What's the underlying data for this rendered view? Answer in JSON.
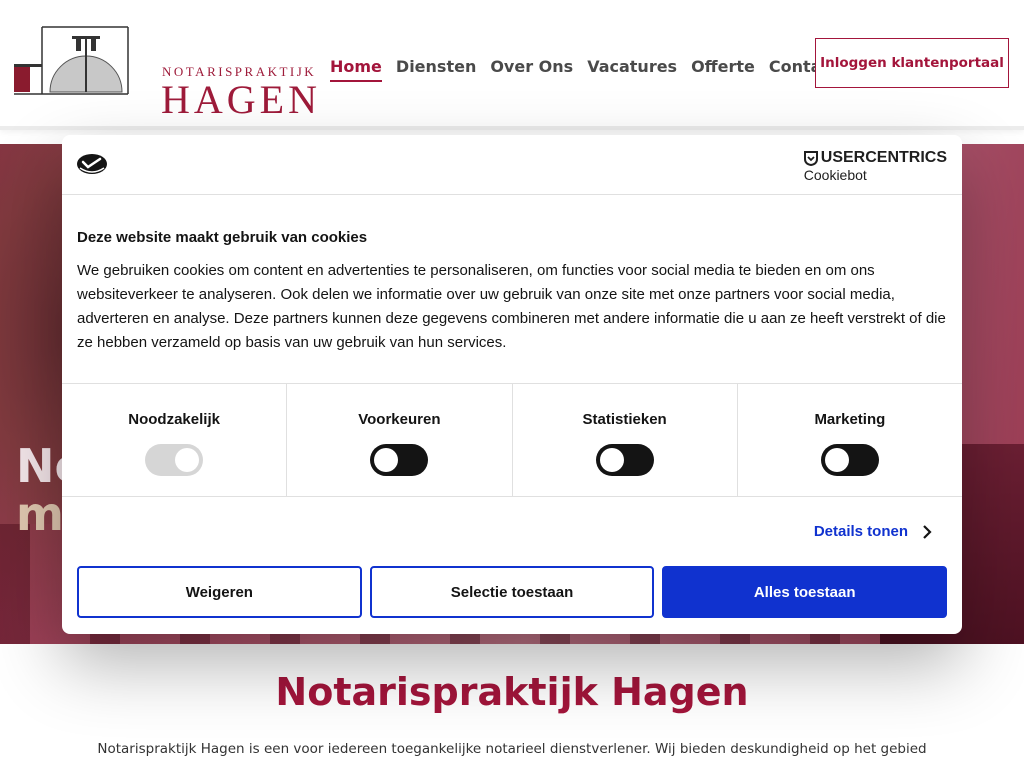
{
  "header": {
    "logo_small": "NOTARISPRAKTIJK",
    "logo_big": "HAGEN",
    "nav": [
      "Home",
      "Diensten",
      "Over Ons",
      "Vacatures",
      "Offerte",
      "Contact"
    ],
    "portal_button": "Inloggen klantenportaal",
    "brand_color": "#a3153b"
  },
  "hero": {
    "text_line1": "Ne",
    "text_line2": "m"
  },
  "intro": {
    "title": "Notarispraktijk Hagen",
    "text": "Notarispraktijk Hagen is een voor iedereen toegankelijke notarieel dienstverlener. Wij bieden deskundigheid op het gebied"
  },
  "cookie": {
    "provider": "USERCENTRICS",
    "provider_sub": "Cookiebot",
    "title": "Deze website maakt gebruik van cookies",
    "text": "We gebruiken cookies om content en advertenties te personaliseren, om functies voor social media te bieden en om ons websiteverkeer te analyseren. Ook delen we informatie over uw gebruik van onze site met onze partners voor social media, adverteren en analyse. Deze partners kunnen deze gegevens combineren met andere informatie die u aan ze heeft verstrekt of die ze hebben verzameld op basis van uw gebruik van hun services.",
    "categories": [
      {
        "label": "Noodzakelijk",
        "state": "on-disabled"
      },
      {
        "label": "Voorkeuren",
        "state": "off"
      },
      {
        "label": "Statistieken",
        "state": "off"
      },
      {
        "label": "Marketing",
        "state": "off"
      }
    ],
    "details_link": "Details tonen",
    "buttons": {
      "decline": "Weigeren",
      "selection": "Selectie toestaan",
      "accept_all": "Alles toestaan"
    },
    "accent_color": "#1032cf"
  }
}
